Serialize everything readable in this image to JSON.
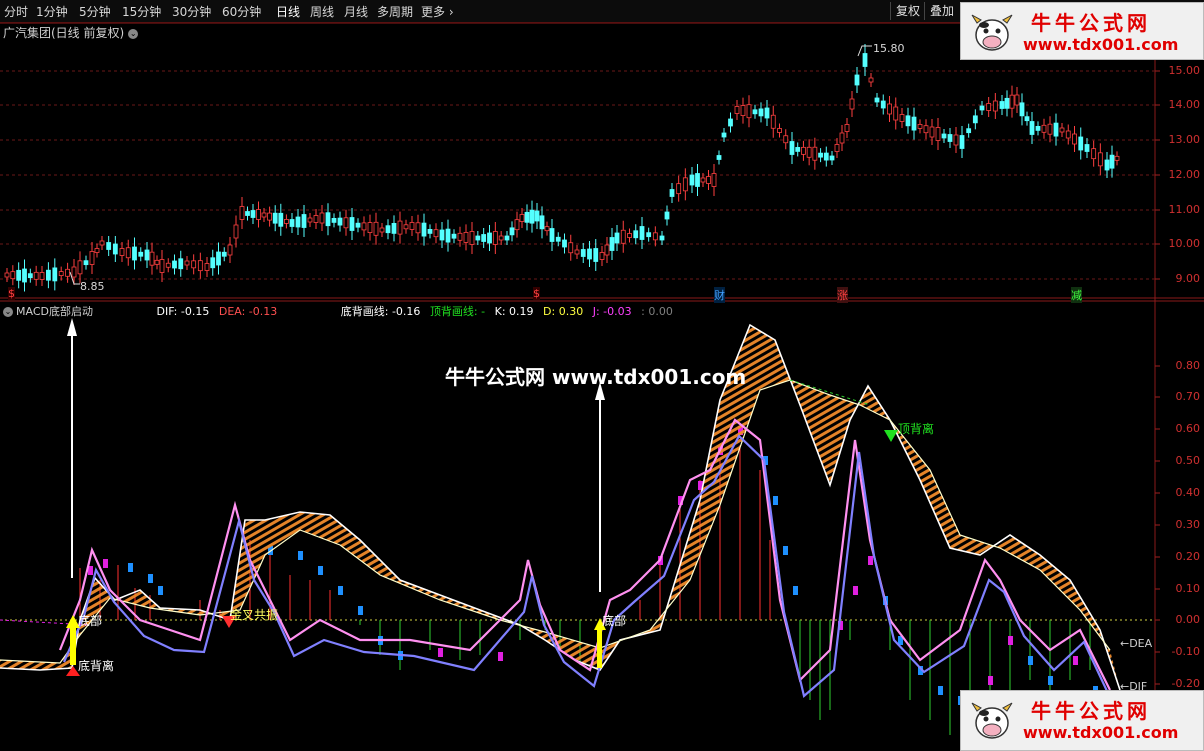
{
  "toolbar": {
    "periods": [
      "分时",
      "1分钟",
      "5分钟",
      "15分钟",
      "30分钟",
      "60分钟",
      "日线",
      "周线",
      "月线",
      "多周期",
      "更多"
    ],
    "active": "日线",
    "right_buttons": [
      "复权",
      "叠加"
    ]
  },
  "stock": {
    "title": "广汽集团(日线 前复权)"
  },
  "price_axis": {
    "labels": [
      "15.00",
      "14.00",
      "13.00",
      "12.00",
      "11.00",
      "10.00",
      "9.00"
    ]
  },
  "price_marks": {
    "high": "15.80",
    "low": "8.85"
  },
  "event_markers": [
    "$",
    "$",
    "财",
    "涨",
    "减"
  ],
  "indicator": {
    "name": "MACD底部启动",
    "items": [
      {
        "label": "DIF: -0.15",
        "color": "#ffffff"
      },
      {
        "label": "DEA: -0.13",
        "color": "#ff5050"
      },
      {
        "label": "底背画线: -0.16",
        "color": "#ffffff"
      },
      {
        "label": "顶背画线: -",
        "color": "#20e020"
      },
      {
        "label": "K: 0.19",
        "color": "#ffffff"
      },
      {
        "label": "D: 0.30",
        "color": "#ffff40"
      },
      {
        "label": "J: -0.03",
        "color": "#ff40ff"
      },
      {
        "label": ": 0.00",
        "color": "#808080"
      }
    ]
  },
  "macd_axis": {
    "labels": [
      "0.80",
      "0.70",
      "0.60",
      "0.50",
      "0.40",
      "0.30",
      "0.20",
      "0.10",
      "0.00",
      "-0.10",
      "-0.20"
    ]
  },
  "annotations": {
    "bottom_divergence": "底背离",
    "bottom": "底部",
    "golden_cross": "金叉共振",
    "top_divergence": "顶背离",
    "dea_tag": "←DEA",
    "dif_tag": "←DIF"
  },
  "watermark": {
    "brand": "牛牛公式网",
    "url": "www.tdx001.com"
  },
  "center_watermark": "牛牛公式网 www.tdx001.com",
  "colors": {
    "up": "#ff4040",
    "down": "#54ffff",
    "border": "#8a1a1a",
    "accent": "#e00000"
  }
}
